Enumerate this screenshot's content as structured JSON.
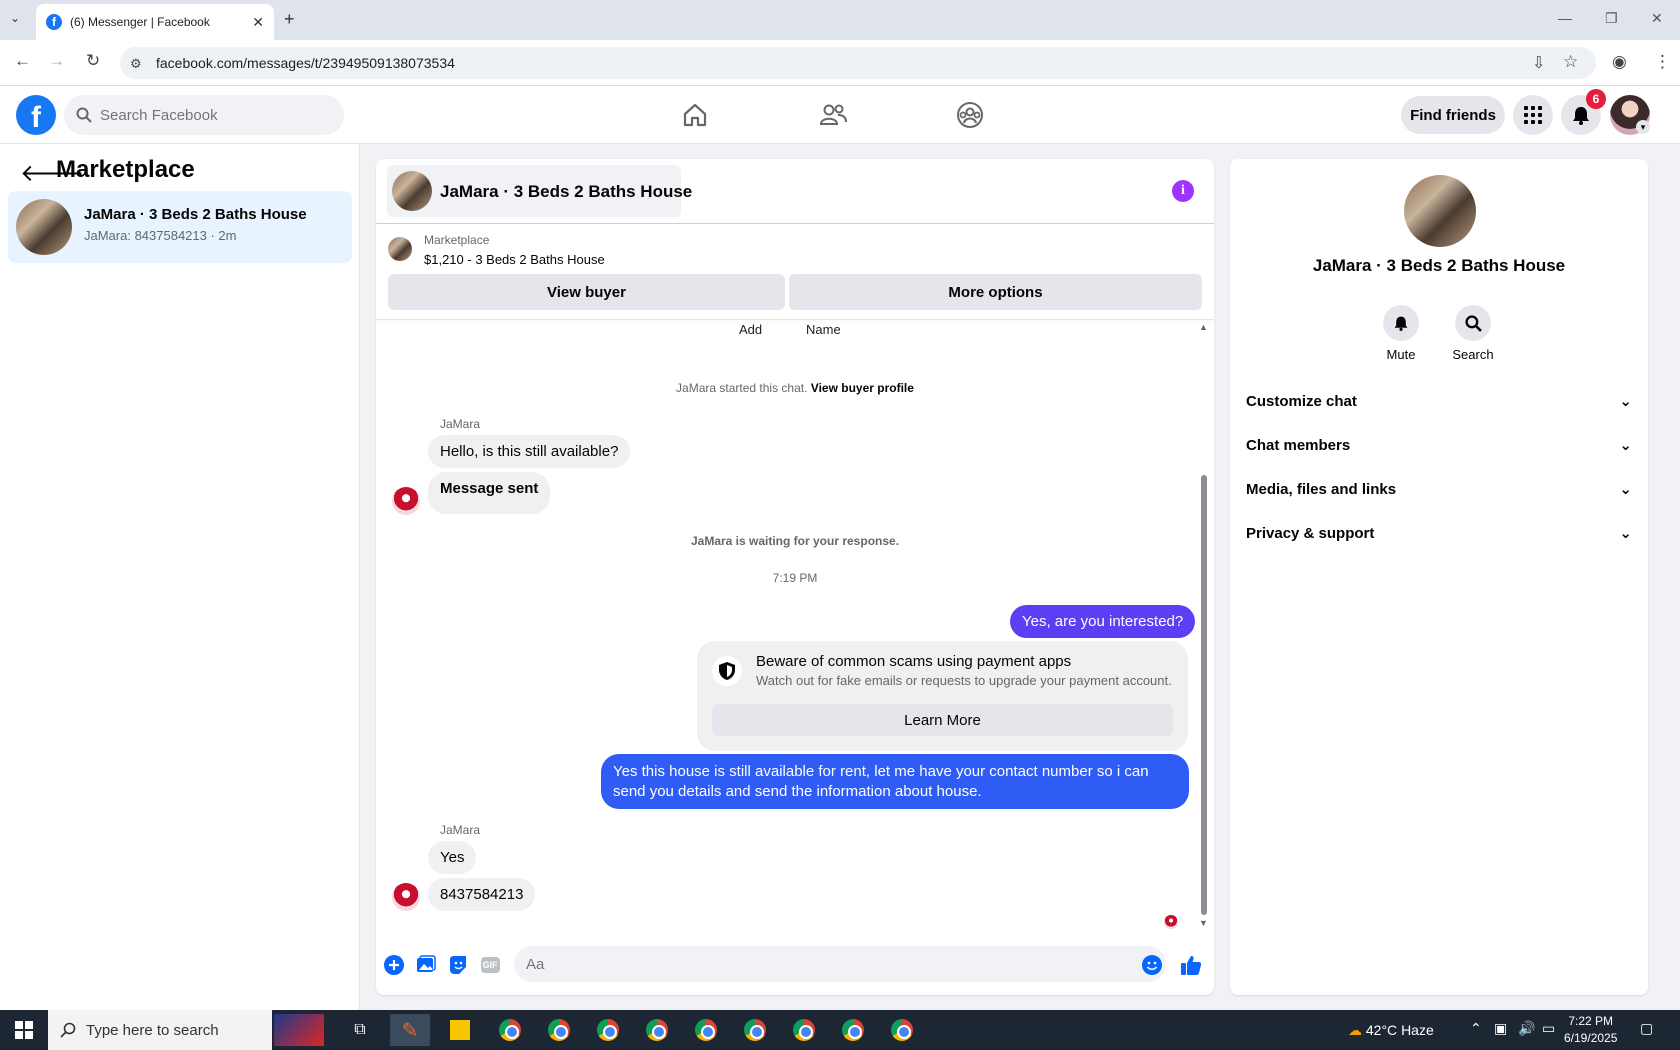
{
  "browser": {
    "tab_title": "(6) Messenger | Facebook",
    "url": "facebook.com/messages/t/23949509138073534"
  },
  "fb_header": {
    "search_placeholder": "Search Facebook",
    "find_friends": "Find friends",
    "notifications_count": "6"
  },
  "left_panel": {
    "title": "Marketplace",
    "conversation": {
      "name": "JaMara · 3 Beds 2 Baths House",
      "preview": "JaMara: 8437584213 · 2m"
    }
  },
  "chat": {
    "header_name": "JaMara · 3 Beds 2 Baths House",
    "marketplace_label": "Marketplace",
    "listing": "$1,210 - 3 Beds 2 Baths House",
    "view_buyer": "View buyer",
    "more_options": "More options",
    "add_label": "Add",
    "name_label": "Name",
    "started_text": "JaMara started this chat.",
    "view_buyer_profile": "View buyer profile",
    "sender_name": "JaMara",
    "msg_hello": "Hello, is this still available?",
    "msg_sent": "Message sent",
    "waiting_text": "JaMara is waiting for your response.",
    "time": "7:19 PM",
    "msg_interested": "Yes, are you interested?",
    "scam_title": "Beware of common scams using payment apps",
    "scam_sub": "Watch out for fake emails or requests to upgrade your payment account.",
    "learn_more": "Learn More",
    "msg_long": "Yes this house is still available for rent, let me have your contact number so i can send you details and send the information about house.",
    "msg_yes": "Yes",
    "msg_number": "8437584213",
    "composer_placeholder": "Aa",
    "gif_label": "GIF"
  },
  "right_panel": {
    "name": "JaMara · 3 Beds 2 Baths House",
    "mute": "Mute",
    "search": "Search",
    "sections": [
      "Customize chat",
      "Chat members",
      "Media, files and links",
      "Privacy & support"
    ]
  },
  "taskbar": {
    "search_placeholder": "Type here to search",
    "temp": "42°C",
    "weather": "Haze",
    "time": "7:22 PM",
    "date": "6/19/2025"
  },
  "colors": {
    "fb_blue": "#1877f2",
    "bubble_out_1": "#5b3ff2",
    "bubble_out_2": "#2f5cf5",
    "info_purple": "#a033ff"
  }
}
